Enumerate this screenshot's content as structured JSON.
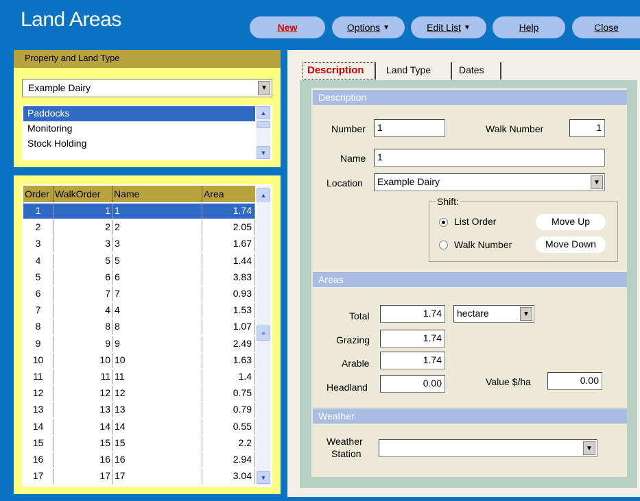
{
  "header": {
    "title": "Land Areas",
    "buttons": {
      "new": "New",
      "options": "Options",
      "edit_list": "Edit List",
      "help": "Help",
      "close": "Close"
    }
  },
  "property_panel": {
    "heading": "Property and Land Type",
    "property_selected": "Example Dairy",
    "land_types": [
      {
        "label": "Paddocks",
        "selected": true
      },
      {
        "label": "Monitoring",
        "selected": false
      },
      {
        "label": "Stock Holding",
        "selected": false
      }
    ]
  },
  "grid": {
    "columns": {
      "order": "Order",
      "walk_order": "WalkOrder",
      "name": "Name",
      "area": "Area"
    },
    "rows": [
      {
        "order": "1",
        "walk": "1",
        "name": "1",
        "area": "1.74"
      },
      {
        "order": "2",
        "walk": "2",
        "name": "2",
        "area": "2.05"
      },
      {
        "order": "3",
        "walk": "3",
        "name": "3",
        "area": "1.67"
      },
      {
        "order": "4",
        "walk": "5",
        "name": "5",
        "area": "1.44"
      },
      {
        "order": "5",
        "walk": "6",
        "name": "6",
        "area": "3.83"
      },
      {
        "order": "6",
        "walk": "7",
        "name": "7",
        "area": "0.93"
      },
      {
        "order": "7",
        "walk": "4",
        "name": "4",
        "area": "1.53"
      },
      {
        "order": "8",
        "walk": "8",
        "name": "8",
        "area": "1.07"
      },
      {
        "order": "9",
        "walk": "9",
        "name": "9",
        "area": "2.49"
      },
      {
        "order": "10",
        "walk": "10",
        "name": "10",
        "area": "1.63"
      },
      {
        "order": "11",
        "walk": "11",
        "name": "11",
        "area": "1.4"
      },
      {
        "order": "12",
        "walk": "12",
        "name": "12",
        "area": "0.75"
      },
      {
        "order": "13",
        "walk": "13",
        "name": "13",
        "area": "0.79"
      },
      {
        "order": "14",
        "walk": "14",
        "name": "14",
        "area": "0.55"
      },
      {
        "order": "15",
        "walk": "15",
        "name": "15",
        "area": "2.2"
      },
      {
        "order": "16",
        "walk": "16",
        "name": "16",
        "area": "2.94"
      },
      {
        "order": "17",
        "walk": "17",
        "name": "17",
        "area": "3.04"
      }
    ],
    "selected_row": 0
  },
  "tabs": {
    "description": "Description",
    "land_type": "Land Type",
    "dates": "Dates"
  },
  "description": {
    "section_title": "Description",
    "number_label": "Number",
    "number_value": "1",
    "walk_number_label": "Walk Number",
    "walk_number_value": "1",
    "name_label": "Name",
    "name_value": "1",
    "location_label": "Location",
    "location_value": "Example Dairy",
    "shift_label": "Shift:",
    "list_order_label": "List Order",
    "walk_number_radio_label": "Walk Number",
    "move_up": "Move Up",
    "move_down": "Move Down"
  },
  "areas": {
    "section_title": "Areas",
    "total_label": "Total",
    "total_value": "1.74",
    "unit": "hectare",
    "grazing_label": "Grazing",
    "grazing_value": "1.74",
    "arable_label": "Arable",
    "arable_value": "1.74",
    "headland_label": "Headland",
    "headland_value": "0.00",
    "value_label": "Value $/ha",
    "value_value": "0.00"
  },
  "weather": {
    "section_title": "Weather",
    "station_label_1": "Weather",
    "station_label_2": "Station",
    "station_value": ""
  },
  "colors": {
    "background": "#0a73c4",
    "panel_yellow": "#ffff80",
    "header_olive": "#b8a43e",
    "selection": "#316ac5",
    "accent_red": "#d10000",
    "section_blue": "#a9bce4"
  }
}
